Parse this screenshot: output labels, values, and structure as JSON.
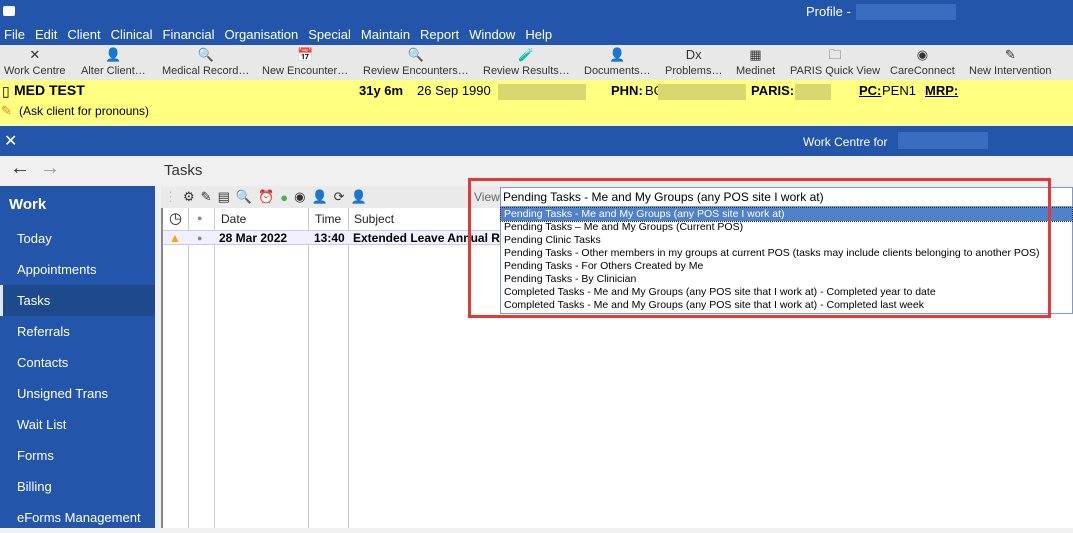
{
  "window": {
    "title": "Profile -"
  },
  "menu": [
    "File",
    "Edit",
    "Client",
    "Clinical",
    "Financial",
    "Organisation",
    "Special",
    "Maintain",
    "Report",
    "Window",
    "Help"
  ],
  "toolbar": [
    {
      "label": "Work Centre",
      "icon": "tools-icon",
      "glyph": "✕"
    },
    {
      "label": "Alter Client…",
      "icon": "person-edit-icon",
      "glyph": "👤"
    },
    {
      "label": "Medical Record…",
      "icon": "magnifier-icon",
      "glyph": "🔍"
    },
    {
      "label": "New Encounter…",
      "icon": "calendar-plus-icon",
      "glyph": "📅"
    },
    {
      "label": "Review Encounters…",
      "icon": "magnifier-icon",
      "glyph": "🔍"
    },
    {
      "label": "Review Results…",
      "icon": "test-tube-icon",
      "glyph": "🧪"
    },
    {
      "label": "Documents…",
      "icon": "person-mail-icon",
      "glyph": "👤"
    },
    {
      "label": "Problems…",
      "icon": "dx-icon",
      "glyph": "Dx"
    },
    {
      "label": "Medinet",
      "icon": "medinet-icon",
      "glyph": "▦"
    },
    {
      "label": "PARIS Quick View",
      "icon": "folder-icon",
      "glyph": "🗀"
    },
    {
      "label": "CareConnect",
      "icon": "careconnect-icon",
      "glyph": "◉"
    },
    {
      "label": "New Intervention",
      "icon": "plus-pen-icon",
      "glyph": "✎"
    }
  ],
  "client": {
    "name": "MED TEST",
    "age": "31y 6m",
    "dob": "26 Sep 1990",
    "phn_label": "PHN:",
    "phn_prefix": "BC",
    "paris_label": "PARIS:",
    "pc_label": "PC:",
    "pc_value": "PEN1",
    "mrp_label": "MRP:",
    "pronouns": "(Ask client for pronouns)"
  },
  "workcentre": {
    "title": "Work Centre for"
  },
  "sidebar": {
    "header": "Work",
    "items": [
      "Today",
      "Appointments",
      "Tasks",
      "Referrals",
      "Contacts",
      "Unsigned Trans",
      "Wait List",
      "Forms",
      "Billing",
      "eForms Management"
    ],
    "selected": "Tasks"
  },
  "tasks": {
    "title": "Tasks",
    "view_label": "View",
    "columns": [
      "Date",
      "Time",
      "Subject"
    ],
    "rows": [
      {
        "date": "28 Mar 2022",
        "time": "13:40",
        "subject": "Extended Leave Annual Re"
      }
    ],
    "view_selected": "Pending Tasks - Me and My Groups (any POS site I work at)",
    "view_options": [
      "Pending Tasks - Me and My Groups (any POS site I work at)",
      "Pending Tasks – Me and My Groups (Current POS)",
      "Pending Clinic Tasks",
      "Pending Tasks - Other members in my groups at current POS (tasks may include clients belonging to another POS)",
      "Pending Tasks - For Others Created by Me",
      "Pending Tasks - By Clinician",
      "Completed Tasks - Me and My Groups (any POS site that I work at) - Completed year to date",
      "Completed Tasks - Me and My Groups (any POS site that I work at) - Completed last week"
    ]
  },
  "colors": {
    "brand": "#2356ab",
    "banner": "#ffff80",
    "highlight": "#e53935",
    "selection": "#4f82cc"
  }
}
